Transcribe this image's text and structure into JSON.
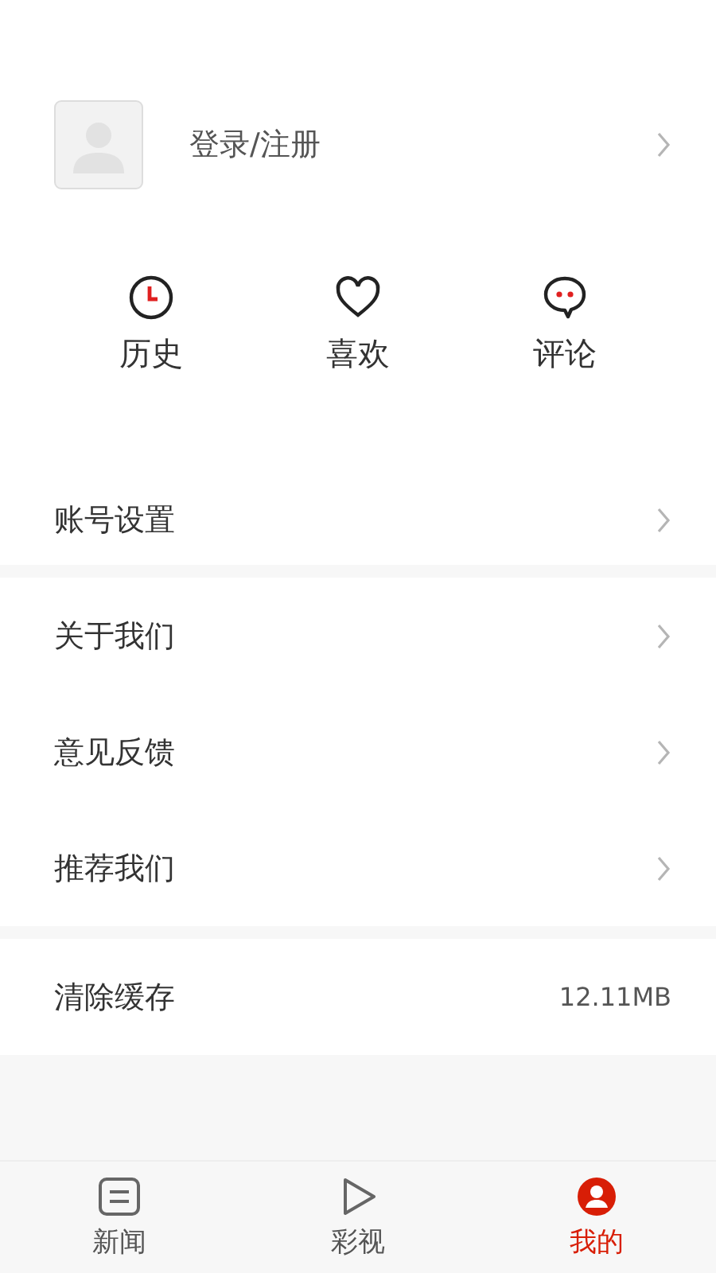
{
  "profile": {
    "label": "登录/注册"
  },
  "shortcuts": [
    {
      "kind": "history",
      "label": "历史"
    },
    {
      "kind": "like",
      "label": "喜欢"
    },
    {
      "kind": "comment",
      "label": "评论"
    }
  ],
  "menu_groups": [
    [
      {
        "label": "账号设置"
      }
    ],
    [
      {
        "label": "关于我们"
      },
      {
        "label": "意见反馈"
      },
      {
        "label": "推荐我们"
      }
    ],
    [
      {
        "label": "清除缓存",
        "value": "12.11MB"
      }
    ]
  ],
  "tabs": [
    {
      "kind": "news",
      "label": "新闻",
      "selected": false
    },
    {
      "kind": "video",
      "label": "彩视",
      "selected": false
    },
    {
      "kind": "me",
      "label": "我的",
      "selected": true
    }
  ]
}
